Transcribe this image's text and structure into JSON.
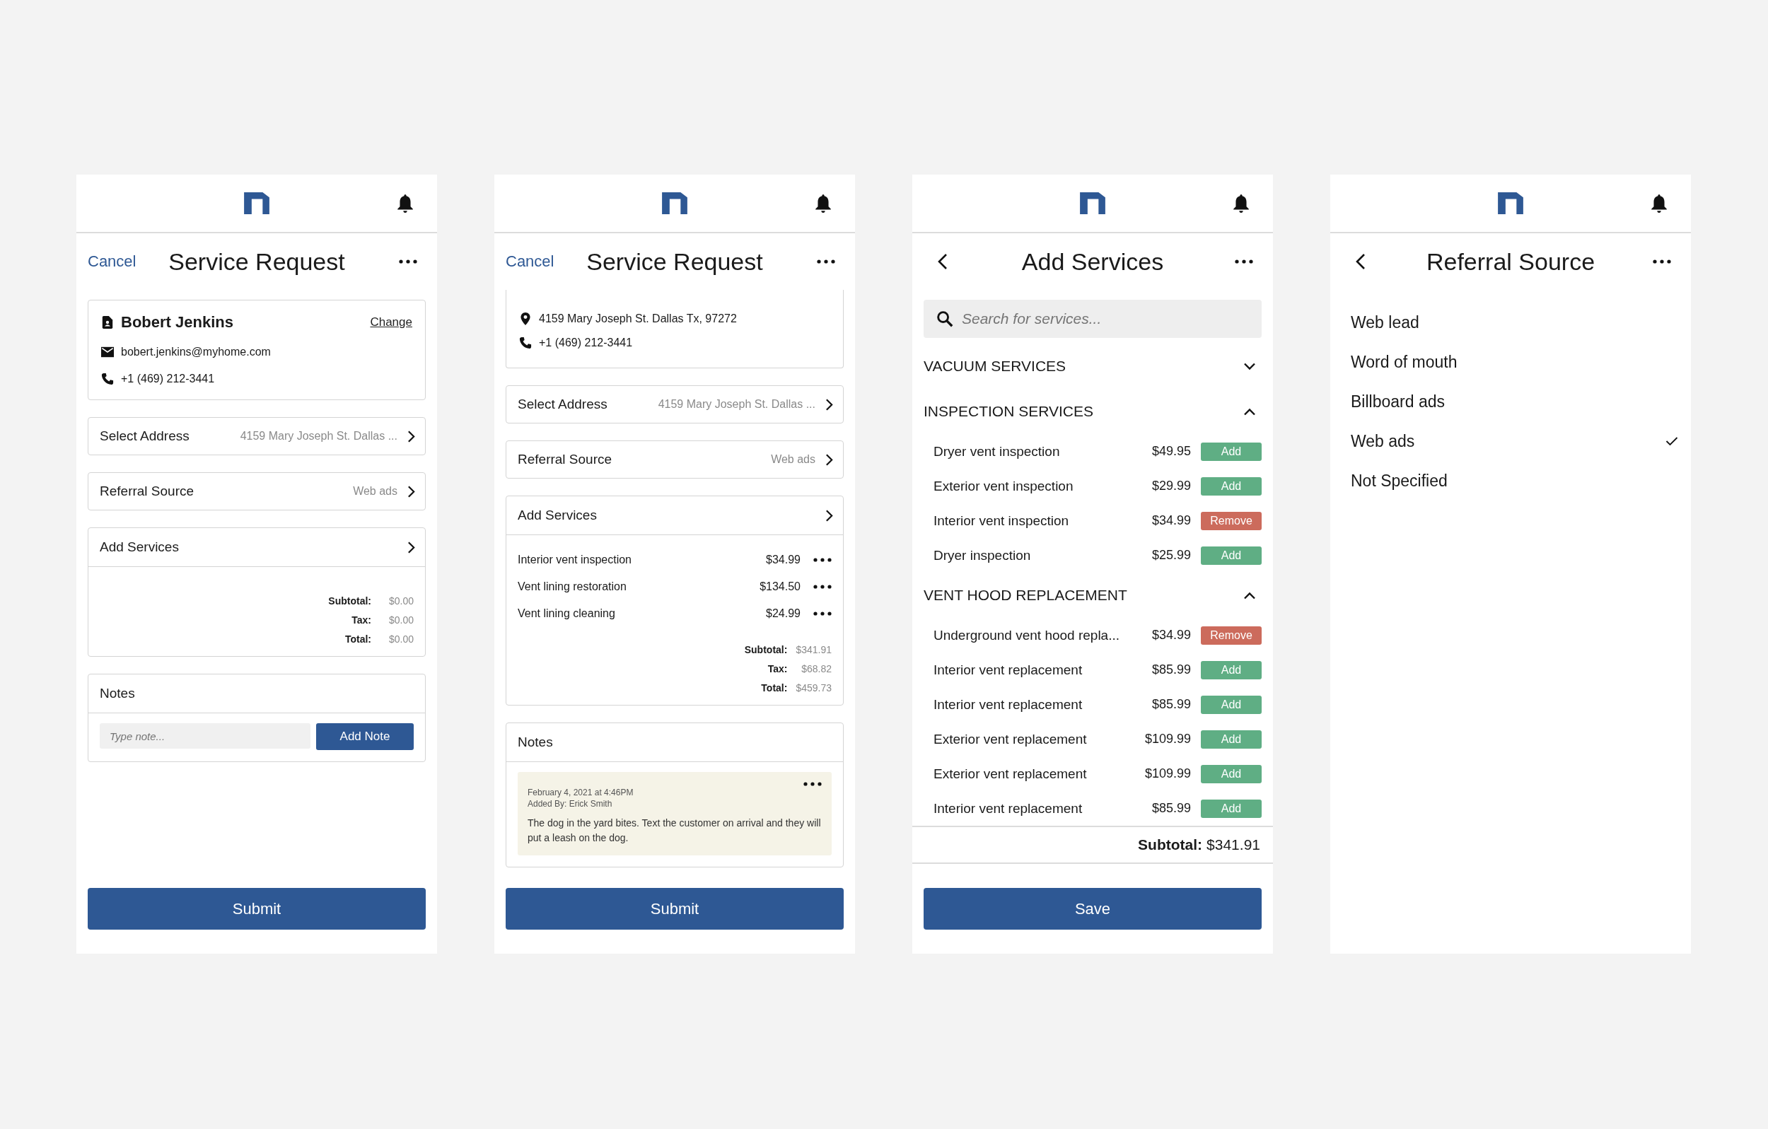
{
  "screens": [
    {
      "kind": "request",
      "nav": {
        "left": {
          "kind": "link",
          "text": "Cancel"
        },
        "title": "Service Request"
      },
      "customer": {
        "name": "Bobert Jenkins",
        "change": "Change",
        "lines": [
          {
            "kind": "email",
            "text": "bobert.jenkins@myhome.com"
          },
          {
            "kind": "phone",
            "text": "+1 (469) 212-3441"
          }
        ]
      },
      "rows": [
        {
          "label": "Select Address",
          "value": "4159 Mary Joseph St. Dallas ..."
        },
        {
          "label": "Referral Source",
          "value": "Web ads"
        }
      ],
      "services": {
        "label": "Add Services",
        "totals": [
          {
            "label": "Subtotal:",
            "value": "$0.00"
          },
          {
            "label": "Tax:",
            "value": "$0.00"
          },
          {
            "label": "Total:",
            "value": "$0.00"
          }
        ]
      },
      "notes": {
        "label": "Notes",
        "input": {
          "placeholder": "Type note...",
          "button": "Add Note"
        }
      },
      "submit": "Submit"
    },
    {
      "kind": "request",
      "nav": {
        "left": {
          "kind": "link",
          "text": "Cancel"
        },
        "title": "Service Request"
      },
      "customer": {
        "lines": [
          {
            "kind": "location",
            "text": "4159 Mary Joseph St. Dallas Tx, 97272"
          },
          {
            "kind": "phone",
            "text": "+1 (469) 212-3441"
          }
        ]
      },
      "rows": [
        {
          "label": "Select Address",
          "value": "4159 Mary Joseph St. Dallas ..."
        },
        {
          "label": "Referral Source",
          "value": "Web ads"
        }
      ],
      "services": {
        "label": "Add Services",
        "items": [
          {
            "name": "Interior vent inspection",
            "price": "$34.99"
          },
          {
            "name": "Vent lining restoration",
            "price": "$134.50"
          },
          {
            "name": "Vent lining cleaning",
            "price": "$24.99"
          }
        ],
        "totals": [
          {
            "label": "Subtotal:",
            "value": "$341.91"
          },
          {
            "label": "Tax:",
            "value": "$68.82"
          },
          {
            "label": "Total:",
            "value": "$459.73"
          }
        ]
      },
      "notes": {
        "label": "Notes",
        "entries": [
          {
            "date": "February 4, 2021 at 4:46PM",
            "author": "Added By: Erick Smith",
            "text": "The dog in the yard bites. Text the customer on arrival and they will put a leash on the dog."
          }
        ]
      },
      "submit": "Submit"
    },
    {
      "kind": "services",
      "nav": {
        "left": {
          "kind": "back"
        },
        "title": "Add Services"
      },
      "search": {
        "placeholder": "Search for services..."
      },
      "groups": [
        {
          "title": "VACUUM SERVICES",
          "expanded": false
        },
        {
          "title": "INSPECTION SERVICES",
          "expanded": true,
          "items": [
            {
              "name": "Dryer vent inspection",
              "price": "$49.95",
              "added": false,
              "action": "Add"
            },
            {
              "name": "Exterior vent inspection",
              "price": "$29.99",
              "added": false,
              "action": "Add"
            },
            {
              "name": "Interior vent inspection",
              "price": "$34.99",
              "added": true,
              "action": "Remove"
            },
            {
              "name": "Dryer inspection",
              "price": "$25.99",
              "added": false,
              "action": "Add"
            }
          ]
        },
        {
          "title": "VENT HOOD REPLACEMENT",
          "expanded": true,
          "items": [
            {
              "name": "Underground vent hood repla...",
              "price": "$34.99",
              "added": true,
              "action": "Remove"
            },
            {
              "name": "Interior vent replacement",
              "price": "$85.99",
              "added": false,
              "action": "Add"
            },
            {
              "name": "Interior vent replacement",
              "price": "$85.99",
              "added": false,
              "action": "Add"
            },
            {
              "name": "Exterior vent replacement",
              "price": "$109.99",
              "added": false,
              "action": "Add"
            },
            {
              "name": "Exterior vent replacement",
              "price": "$109.99",
              "added": false,
              "action": "Add"
            },
            {
              "name": "Interior vent replacement",
              "price": "$85.99",
              "added": false,
              "action": "Add"
            }
          ]
        }
      ],
      "subtotal": {
        "label": "Subtotal:",
        "value": "$341.91"
      },
      "save": "Save"
    },
    {
      "kind": "picker",
      "nav": {
        "left": {
          "kind": "back"
        },
        "title": "Referral Source"
      },
      "options": [
        {
          "label": "Web lead",
          "selected": false
        },
        {
          "label": "Word of mouth",
          "selected": false
        },
        {
          "label": "Billboard ads",
          "selected": false
        },
        {
          "label": "Web ads",
          "selected": true
        },
        {
          "label": "Not Specified",
          "selected": false
        }
      ]
    }
  ]
}
